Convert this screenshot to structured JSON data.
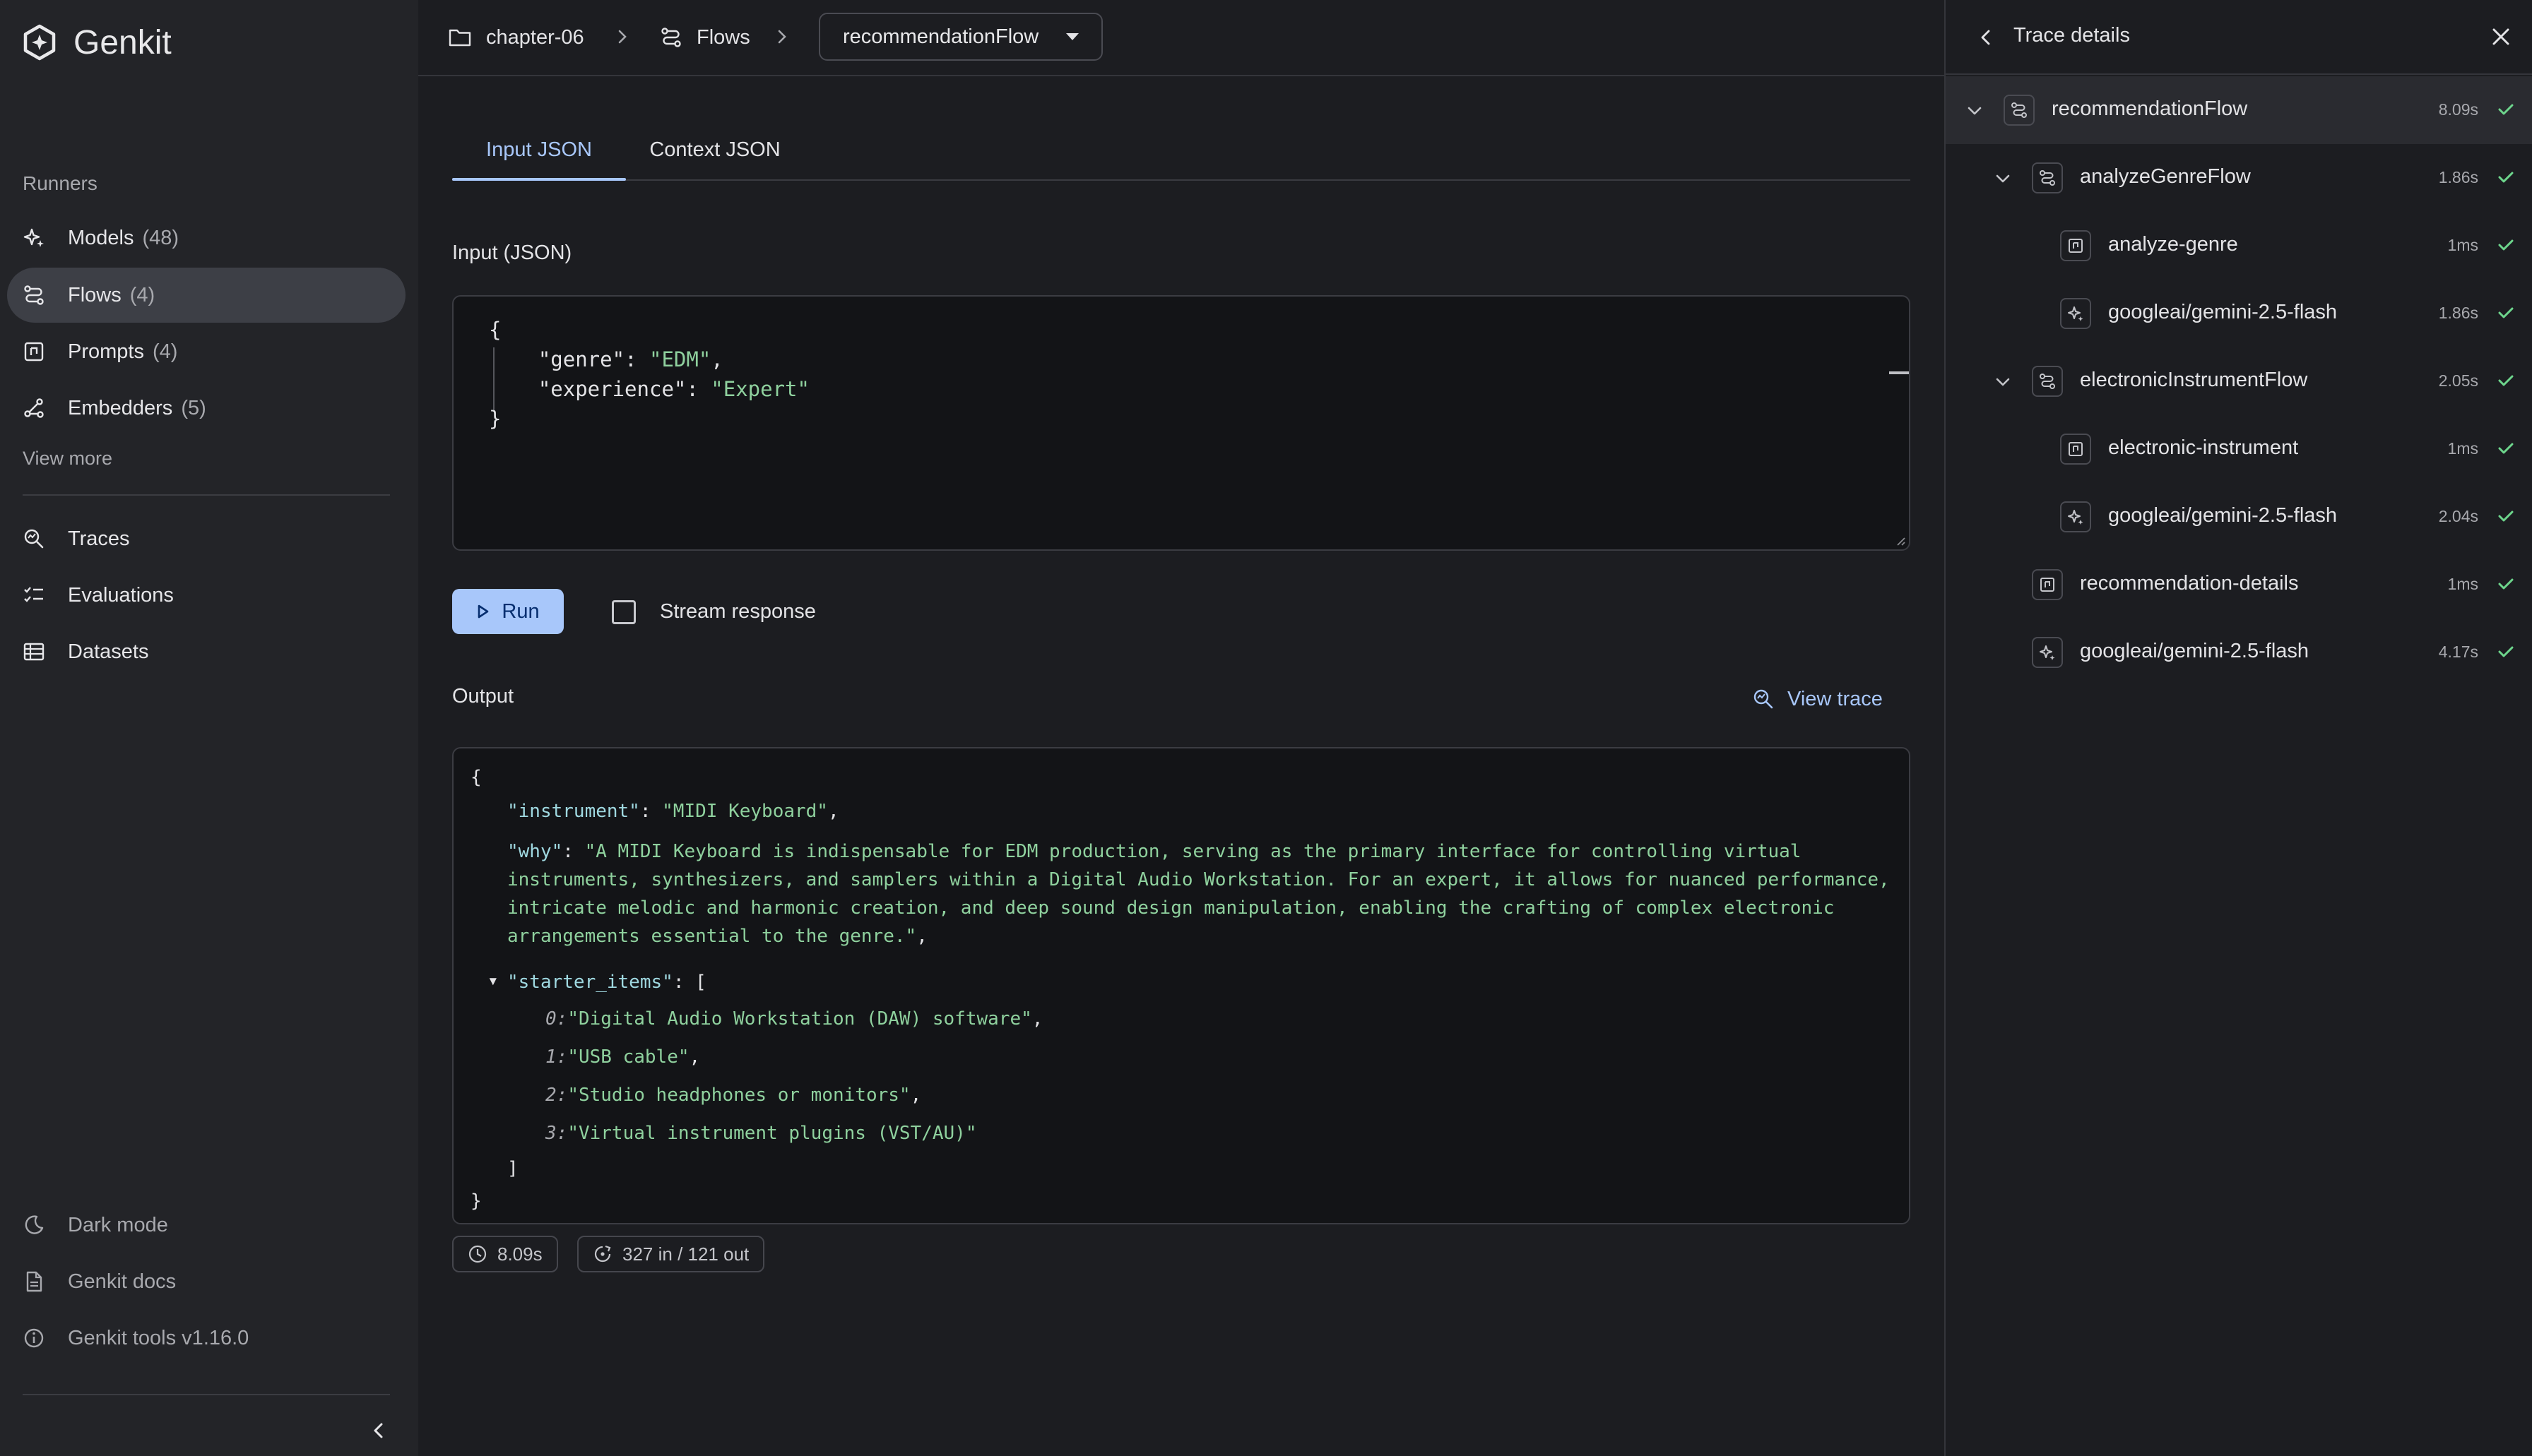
{
  "app": {
    "name": "Genkit"
  },
  "sidebar": {
    "section_label": "Runners",
    "runners": [
      {
        "label": "Models",
        "count": "(48)",
        "icon": "sparkle-icon"
      },
      {
        "label": "Flows",
        "count": "(4)",
        "icon": "flow-icon",
        "active": true
      },
      {
        "label": "Prompts",
        "count": "(4)",
        "icon": "prompt-icon"
      },
      {
        "label": "Embedders",
        "count": "(5)",
        "icon": "embedder-icon"
      }
    ],
    "view_more": "View more",
    "tools": [
      {
        "label": "Traces",
        "icon": "trace-search-icon"
      },
      {
        "label": "Evaluations",
        "icon": "checklist-icon"
      },
      {
        "label": "Datasets",
        "icon": "table-icon"
      }
    ],
    "bottom": [
      {
        "label": "Dark mode",
        "icon": "moon-icon"
      },
      {
        "label": "Genkit docs",
        "icon": "document-icon"
      },
      {
        "label": "Genkit tools v1.16.0",
        "icon": "info-icon"
      }
    ]
  },
  "header": {
    "breadcrumb": [
      {
        "label": "chapter-06",
        "icon": "folder-icon"
      },
      {
        "label": "Flows",
        "icon": "flow-icon"
      }
    ],
    "selected_flow": "recommendationFlow"
  },
  "main": {
    "tabs": [
      {
        "label": "Input JSON",
        "active": true
      },
      {
        "label": "Context JSON",
        "active": false
      }
    ],
    "input_label": "Input (JSON)",
    "input": {
      "open": "{",
      "close": "}",
      "lines": [
        {
          "key": "\"genre\"",
          "value": "\"EDM\"",
          "trail": ","
        },
        {
          "key": "\"experience\"",
          "value": "\"Expert\"",
          "trail": ""
        }
      ]
    },
    "run_label": "Run",
    "stream_label": "Stream response",
    "stream_checked": false,
    "output_label": "Output",
    "view_trace_label": "View trace",
    "output": {
      "open": "{",
      "close": "}",
      "instrument_key": "\"instrument\"",
      "instrument_value": "\"MIDI Keyboard\"",
      "why_key": "\"why\"",
      "why_value": "\"A MIDI Keyboard is indispensable for EDM production, serving as the primary interface for controlling virtual instruments, synthesizers, and samplers within a Digital Audio Workstation. For an expert, it allows for nuanced performance, intricate melodic and harmonic creation, and deep sound design manipulation, enabling the crafting of complex electronic arrangements essential to the genre.\"",
      "starter_key": "\"starter_items\"",
      "array_open": "[",
      "array_close": "]",
      "starter_items": [
        {
          "index": "0:",
          "value": "\"Digital Audio Workstation (DAW) software\""
        },
        {
          "index": "1:",
          "value": "\"USB cable\""
        },
        {
          "index": "2:",
          "value": "\"Studio headphones or monitors\""
        },
        {
          "index": "3:",
          "value": "\"Virtual instrument plugins (VST/AU)\""
        }
      ]
    },
    "stats": {
      "duration": "8.09s",
      "tokens": "327 in / 121 out"
    }
  },
  "trace_panel": {
    "title": "Trace details",
    "spans": [
      {
        "name": "recommendationFlow",
        "duration": "8.09s",
        "icon": "flow-icon",
        "depth": 0,
        "expandable": true
      },
      {
        "name": "analyzeGenreFlow",
        "duration": "1.86s",
        "icon": "flow-icon",
        "depth": 1,
        "expandable": true
      },
      {
        "name": "analyze-genre",
        "duration": "1ms",
        "icon": "prompt-icon",
        "depth": 2,
        "expandable": false
      },
      {
        "name": "googleai/gemini-2.5-flash",
        "duration": "1.86s",
        "icon": "sparkle-icon",
        "depth": 2,
        "expandable": false
      },
      {
        "name": "electronicInstrumentFlow",
        "duration": "2.05s",
        "icon": "flow-icon",
        "depth": 1,
        "expandable": true
      },
      {
        "name": "electronic-instrument",
        "duration": "1ms",
        "icon": "prompt-icon",
        "depth": 2,
        "expandable": false
      },
      {
        "name": "googleai/gemini-2.5-flash",
        "duration": "2.04s",
        "icon": "sparkle-icon",
        "depth": 2,
        "expandable": false
      },
      {
        "name": "recommendation-details",
        "duration": "1ms",
        "icon": "prompt-icon",
        "depth": 1,
        "expandable": false
      },
      {
        "name": "googleai/gemini-2.5-flash",
        "duration": "4.17s",
        "icon": "sparkle-icon",
        "depth": 1,
        "expandable": false
      }
    ],
    "colors": {
      "success": "#6dd58c",
      "accent": "#a8c7fa"
    }
  }
}
